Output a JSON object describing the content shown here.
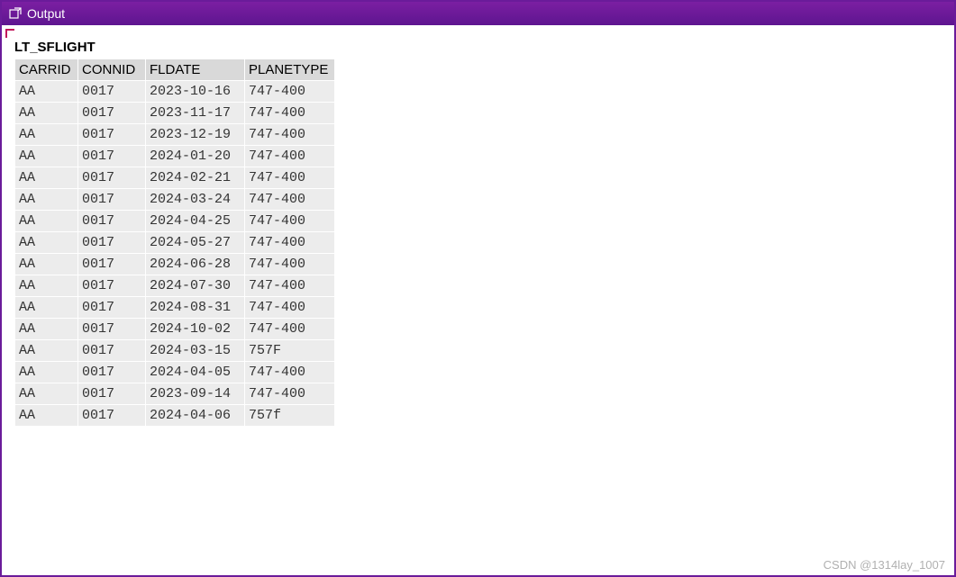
{
  "window": {
    "title": "Output"
  },
  "table": {
    "name": "LT_SFLIGHT",
    "columns": [
      "CARRID",
      "CONNID",
      "FLDATE",
      "PLANETYPE"
    ],
    "rows": [
      {
        "carrid": "AA",
        "connid": "0017",
        "fldate": "2023-10-16",
        "planetype": "747-400"
      },
      {
        "carrid": "AA",
        "connid": "0017",
        "fldate": "2023-11-17",
        "planetype": "747-400"
      },
      {
        "carrid": "AA",
        "connid": "0017",
        "fldate": "2023-12-19",
        "planetype": "747-400"
      },
      {
        "carrid": "AA",
        "connid": "0017",
        "fldate": "2024-01-20",
        "planetype": "747-400"
      },
      {
        "carrid": "AA",
        "connid": "0017",
        "fldate": "2024-02-21",
        "planetype": "747-400"
      },
      {
        "carrid": "AA",
        "connid": "0017",
        "fldate": "2024-03-24",
        "planetype": "747-400"
      },
      {
        "carrid": "AA",
        "connid": "0017",
        "fldate": "2024-04-25",
        "planetype": "747-400"
      },
      {
        "carrid": "AA",
        "connid": "0017",
        "fldate": "2024-05-27",
        "planetype": "747-400"
      },
      {
        "carrid": "AA",
        "connid": "0017",
        "fldate": "2024-06-28",
        "planetype": "747-400"
      },
      {
        "carrid": "AA",
        "connid": "0017",
        "fldate": "2024-07-30",
        "planetype": "747-400"
      },
      {
        "carrid": "AA",
        "connid": "0017",
        "fldate": "2024-08-31",
        "planetype": "747-400"
      },
      {
        "carrid": "AA",
        "connid": "0017",
        "fldate": "2024-10-02",
        "planetype": "747-400"
      },
      {
        "carrid": "AA",
        "connid": "0017",
        "fldate": "2024-03-15",
        "planetype": "757F"
      },
      {
        "carrid": "AA",
        "connid": "0017",
        "fldate": "2024-04-05",
        "planetype": "747-400"
      },
      {
        "carrid": "AA",
        "connid": "0017",
        "fldate": "2023-09-14",
        "planetype": "747-400"
      },
      {
        "carrid": "AA",
        "connid": "0017",
        "fldate": "2024-04-06",
        "planetype": "757f"
      }
    ]
  },
  "watermark": "CSDN @1314lay_1007"
}
